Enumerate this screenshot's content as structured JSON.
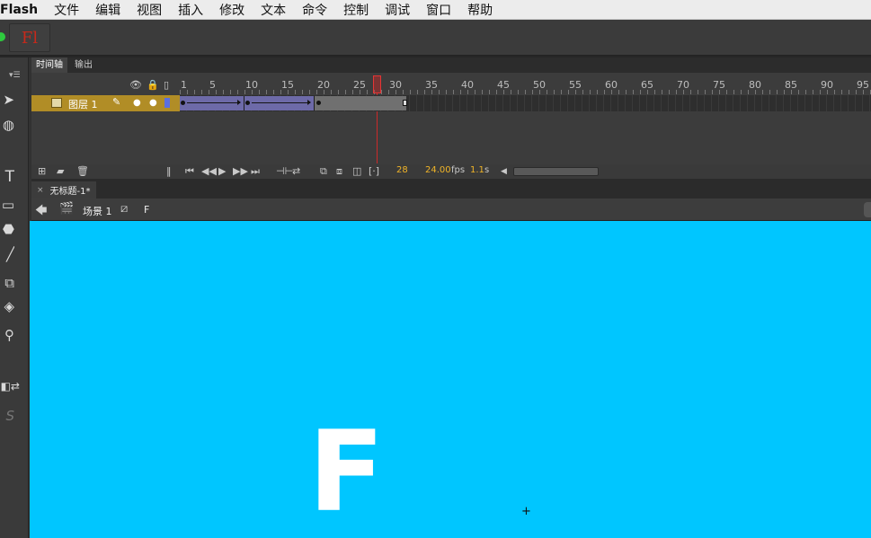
{
  "menubar": {
    "app_name": "Flash",
    "items": [
      "文件",
      "编辑",
      "视图",
      "插入",
      "修改",
      "文本",
      "命令",
      "控制",
      "调试",
      "窗口",
      "帮助"
    ]
  },
  "appbar": {
    "logo_text": "Fl"
  },
  "tools": {
    "text_tool_label": "T",
    "items": [
      "selection-icon",
      "3d-rotation-icon",
      "text-icon",
      "rectangle-icon",
      "polygon-icon",
      "brush-icon",
      "paint-bucket-icon",
      "eraser-icon",
      "zoom-icon",
      "swap-colors-icon",
      "stroke-icon"
    ]
  },
  "timeline": {
    "tabs": [
      "时间轴",
      "输出"
    ],
    "active_tab": "时间轴",
    "ruler_numbers": [
      "1",
      "5",
      "10",
      "15",
      "20",
      "25",
      "30",
      "35",
      "40",
      "45",
      "50",
      "55",
      "60",
      "65",
      "70",
      "75",
      "80",
      "85",
      "90",
      "95"
    ],
    "layer": {
      "name": "图层 1"
    },
    "current_frame": "28",
    "fps_value": "24.00",
    "fps_unit": "fps",
    "time_value": "1.1",
    "time_unit": "s",
    "colors": {
      "layer_highlight": "#b18d26",
      "tween": "#6d6aa8",
      "playhead": "#e53535",
      "value_text": "#f0b428"
    }
  },
  "document": {
    "tab_title": "无标题-1*",
    "close_glyph": "×"
  },
  "editbar": {
    "scene_label": "场景 1",
    "symbol_label": "F"
  },
  "stage": {
    "content_text": "F",
    "background_color": "#00c6ff"
  }
}
